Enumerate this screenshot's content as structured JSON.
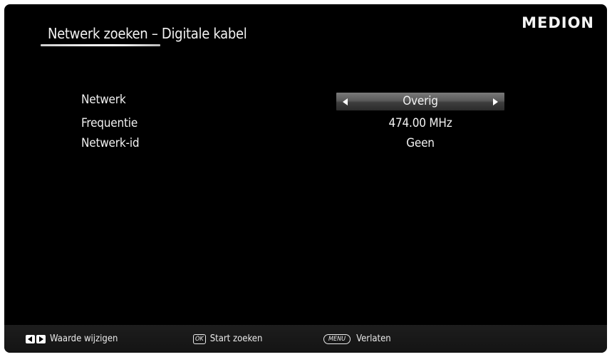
{
  "header": {
    "title": "Netwerk zoeken – Digitale kabel",
    "logo": "MEDION"
  },
  "settings": [
    {
      "label": "Netwerk",
      "value": "Overig",
      "selected": true
    },
    {
      "label": "Frequentie",
      "value": "474.00 MHz",
      "selected": false
    },
    {
      "label": "Netwerk-id",
      "value": "Geen",
      "selected": false
    }
  ],
  "footer": {
    "change_value": "Waarde wijzigen",
    "ok_key": "OK",
    "start_search": "Start zoeken",
    "menu_key": "MENU",
    "exit": "Verlaten"
  },
  "icons": {
    "left_arrow": "left-arrow-icon",
    "right_arrow": "right-arrow-icon"
  }
}
